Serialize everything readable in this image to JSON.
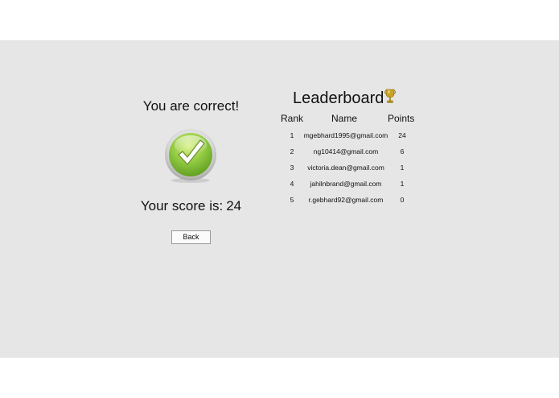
{
  "result": {
    "title": "You are correct!",
    "score_label": "Your score is:",
    "score_value": "24",
    "back_label": "Back"
  },
  "leaderboard": {
    "title": "Leaderboard",
    "columns": {
      "rank": "Rank",
      "name": "Name",
      "points": "Points"
    },
    "rows": [
      {
        "rank": "1",
        "name": "mgebhard1995@gmail.com",
        "points": "24"
      },
      {
        "rank": "2",
        "name": "ng10414@gmail.com",
        "points": "6"
      },
      {
        "rank": "3",
        "name": "victoria.dean@gmail.com",
        "points": "1"
      },
      {
        "rank": "4",
        "name": "jahilnbrand@gmail.com",
        "points": "1"
      },
      {
        "rank": "5",
        "name": "r.gebhard92@gmail.com",
        "points": "0"
      }
    ]
  },
  "icons": {
    "checkmark": "checkmark-icon",
    "trophy": "trophy-icon"
  },
  "colors": {
    "background": "#e6e6e6",
    "check_green": "#8cc63f",
    "trophy_gold": "#c9a227"
  }
}
